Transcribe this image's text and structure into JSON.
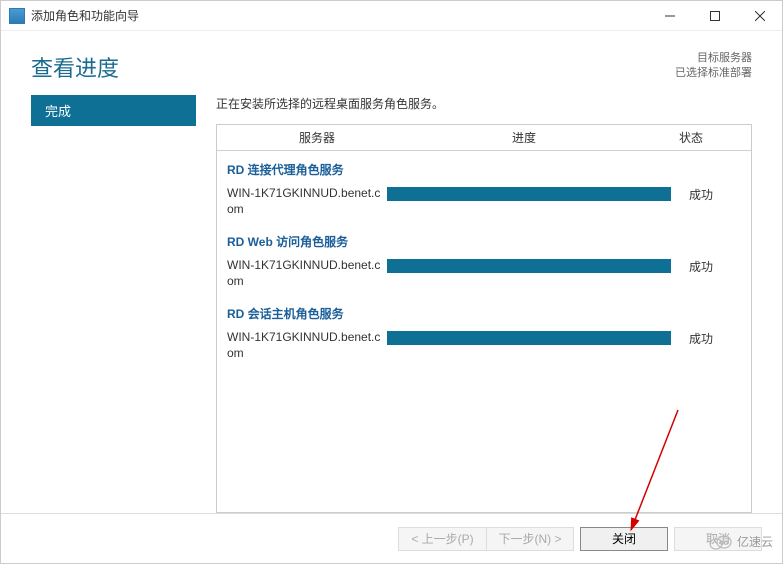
{
  "window": {
    "title": "添加角色和功能向导"
  },
  "header": {
    "page_title": "查看进度",
    "target_label": "目标服务器",
    "target_value": "已选择标准部署"
  },
  "sidebar": {
    "step_active": "完成"
  },
  "content": {
    "install_message": "正在安装所选择的远程桌面服务角色服务。",
    "columns": {
      "server": "服务器",
      "progress": "进度",
      "status": "状态"
    },
    "services": [
      {
        "title": "RD 连接代理角色服务",
        "server": "WIN-1K71GKINNUD.benet.com",
        "status": "成功"
      },
      {
        "title": "RD Web 访问角色服务",
        "server": "WIN-1K71GKINNUD.benet.com",
        "status": "成功"
      },
      {
        "title": "RD 会话主机角色服务",
        "server": "WIN-1K71GKINNUD.benet.com",
        "status": "成功"
      }
    ]
  },
  "footer": {
    "prev": "< 上一步(P)",
    "next": "下一步(N) >",
    "close": "关闭",
    "cancel": "取消"
  },
  "watermark": "亿速云"
}
